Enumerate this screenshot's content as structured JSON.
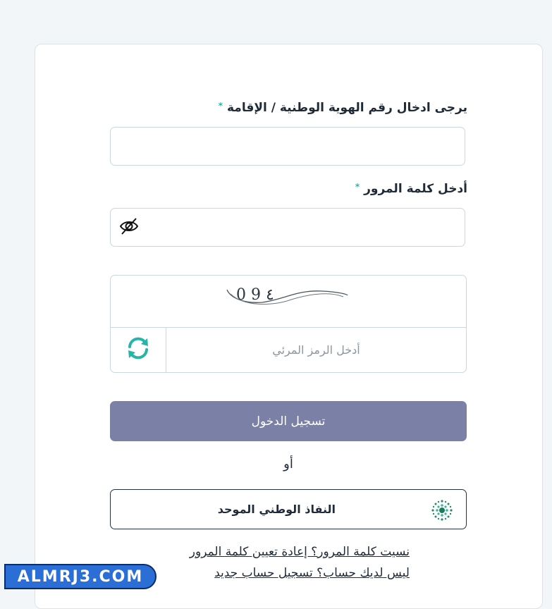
{
  "form": {
    "id_label": "يرجى ادخال رقم الهوية الوطنية / الإقامة",
    "id_required": "*",
    "id_value": "",
    "password_label": "أدخل كلمة المرور",
    "password_required": "*",
    "password_value": "",
    "captcha_text": "0 9 ٤",
    "captcha_placeholder": "أدخل الرمز المرئي",
    "login_label": "تسجيل الدخول",
    "or_label": "أو",
    "nafath_label": "النفاذ الوطني الموحد",
    "forgot_link": "نسيت كلمة المرور؟ إعادة تعيين كلمة المرور",
    "register_link": "ليس لديك حساب؟ تسجيل حساب جديد"
  },
  "watermark": {
    "text": "ALMRJ3.COM"
  },
  "icons": {
    "eye": "eye-slash-icon",
    "refresh": "refresh-icon",
    "nafath": "nafath-logo-icon"
  },
  "colors": {
    "accent": "#27b5a8",
    "login_button": "#7a80a6",
    "border": "#c9d8de"
  }
}
